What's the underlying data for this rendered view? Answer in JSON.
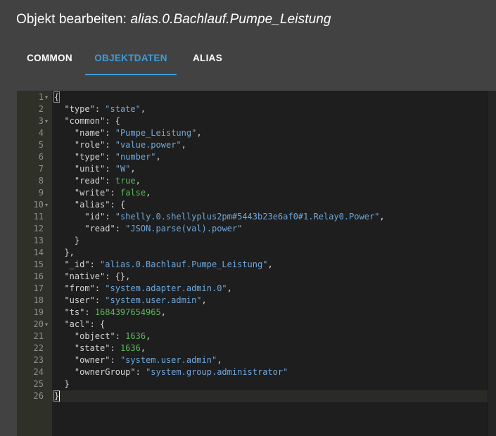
{
  "dialog": {
    "title_prefix": "Objekt bearbeiten: ",
    "title_object": "alias.0.Bachlauf.Pumpe_Leistung"
  },
  "tabs": [
    {
      "label": "COMMON",
      "active": false
    },
    {
      "label": "OBJEKTDATEN",
      "active": true
    },
    {
      "label": "ALIAS",
      "active": false
    }
  ],
  "editor": {
    "active_line": 26,
    "fold_lines": [
      1,
      3,
      10,
      20
    ],
    "lines": [
      [
        {
          "t": "p",
          "v": "{"
        }
      ],
      [
        {
          "t": "p",
          "v": "  "
        },
        {
          "t": "k",
          "v": "\"type\""
        },
        {
          "t": "p",
          "v": ": "
        },
        {
          "t": "s",
          "v": "\"state\""
        },
        {
          "t": "p",
          "v": ","
        }
      ],
      [
        {
          "t": "p",
          "v": "  "
        },
        {
          "t": "k",
          "v": "\"common\""
        },
        {
          "t": "p",
          "v": ": {"
        }
      ],
      [
        {
          "t": "p",
          "v": "    "
        },
        {
          "t": "k",
          "v": "\"name\""
        },
        {
          "t": "p",
          "v": ": "
        },
        {
          "t": "s",
          "v": "\"Pumpe_Leistung\""
        },
        {
          "t": "p",
          "v": ","
        }
      ],
      [
        {
          "t": "p",
          "v": "    "
        },
        {
          "t": "k",
          "v": "\"role\""
        },
        {
          "t": "p",
          "v": ": "
        },
        {
          "t": "s",
          "v": "\"value.power\""
        },
        {
          "t": "p",
          "v": ","
        }
      ],
      [
        {
          "t": "p",
          "v": "    "
        },
        {
          "t": "k",
          "v": "\"type\""
        },
        {
          "t": "p",
          "v": ": "
        },
        {
          "t": "s",
          "v": "\"number\""
        },
        {
          "t": "p",
          "v": ","
        }
      ],
      [
        {
          "t": "p",
          "v": "    "
        },
        {
          "t": "k",
          "v": "\"unit\""
        },
        {
          "t": "p",
          "v": ": "
        },
        {
          "t": "s",
          "v": "\"W\""
        },
        {
          "t": "p",
          "v": ","
        }
      ],
      [
        {
          "t": "p",
          "v": "    "
        },
        {
          "t": "k",
          "v": "\"read\""
        },
        {
          "t": "p",
          "v": ": "
        },
        {
          "t": "b",
          "v": "true"
        },
        {
          "t": "p",
          "v": ","
        }
      ],
      [
        {
          "t": "p",
          "v": "    "
        },
        {
          "t": "k",
          "v": "\"write\""
        },
        {
          "t": "p",
          "v": ": "
        },
        {
          "t": "b",
          "v": "false"
        },
        {
          "t": "p",
          "v": ","
        }
      ],
      [
        {
          "t": "p",
          "v": "    "
        },
        {
          "t": "k",
          "v": "\"alias\""
        },
        {
          "t": "p",
          "v": ": {"
        }
      ],
      [
        {
          "t": "p",
          "v": "      "
        },
        {
          "t": "k",
          "v": "\"id\""
        },
        {
          "t": "p",
          "v": ": "
        },
        {
          "t": "s",
          "v": "\"shelly.0.shellyplus2pm#5443b23e6af0#1.Relay0.Power\""
        },
        {
          "t": "p",
          "v": ","
        }
      ],
      [
        {
          "t": "p",
          "v": "      "
        },
        {
          "t": "k",
          "v": "\"read\""
        },
        {
          "t": "p",
          "v": ": "
        },
        {
          "t": "s",
          "v": "\"JSON.parse(val).power\""
        }
      ],
      [
        {
          "t": "p",
          "v": "    }"
        }
      ],
      [
        {
          "t": "p",
          "v": "  },"
        }
      ],
      [
        {
          "t": "p",
          "v": "  "
        },
        {
          "t": "k",
          "v": "\"_id\""
        },
        {
          "t": "p",
          "v": ": "
        },
        {
          "t": "s",
          "v": "\"alias.0.Bachlauf.Pumpe_Leistung\""
        },
        {
          "t": "p",
          "v": ","
        }
      ],
      [
        {
          "t": "p",
          "v": "  "
        },
        {
          "t": "k",
          "v": "\"native\""
        },
        {
          "t": "p",
          "v": ": {},"
        }
      ],
      [
        {
          "t": "p",
          "v": "  "
        },
        {
          "t": "k",
          "v": "\"from\""
        },
        {
          "t": "p",
          "v": ": "
        },
        {
          "t": "s",
          "v": "\"system.adapter.admin.0\""
        },
        {
          "t": "p",
          "v": ","
        }
      ],
      [
        {
          "t": "p",
          "v": "  "
        },
        {
          "t": "k",
          "v": "\"user\""
        },
        {
          "t": "p",
          "v": ": "
        },
        {
          "t": "s",
          "v": "\"system.user.admin\""
        },
        {
          "t": "p",
          "v": ","
        }
      ],
      [
        {
          "t": "p",
          "v": "  "
        },
        {
          "t": "k",
          "v": "\"ts\""
        },
        {
          "t": "p",
          "v": ": "
        },
        {
          "t": "n",
          "v": "1684397654965"
        },
        {
          "t": "p",
          "v": ","
        }
      ],
      [
        {
          "t": "p",
          "v": "  "
        },
        {
          "t": "k",
          "v": "\"acl\""
        },
        {
          "t": "p",
          "v": ": {"
        }
      ],
      [
        {
          "t": "p",
          "v": "    "
        },
        {
          "t": "k",
          "v": "\"object\""
        },
        {
          "t": "p",
          "v": ": "
        },
        {
          "t": "n",
          "v": "1636"
        },
        {
          "t": "p",
          "v": ","
        }
      ],
      [
        {
          "t": "p",
          "v": "    "
        },
        {
          "t": "k",
          "v": "\"state\""
        },
        {
          "t": "p",
          "v": ": "
        },
        {
          "t": "n",
          "v": "1636"
        },
        {
          "t": "p",
          "v": ","
        }
      ],
      [
        {
          "t": "p",
          "v": "    "
        },
        {
          "t": "k",
          "v": "\"owner\""
        },
        {
          "t": "p",
          "v": ": "
        },
        {
          "t": "s",
          "v": "\"system.user.admin\""
        },
        {
          "t": "p",
          "v": ","
        }
      ],
      [
        {
          "t": "p",
          "v": "    "
        },
        {
          "t": "k",
          "v": "\"ownerGroup\""
        },
        {
          "t": "p",
          "v": ": "
        },
        {
          "t": "s",
          "v": "\"system.group.administrator\""
        }
      ],
      [
        {
          "t": "p",
          "v": "  }"
        }
      ],
      [
        {
          "t": "p",
          "v": "}"
        }
      ]
    ]
  },
  "colors": {
    "background": "#424242",
    "accent": "#3e9bd6",
    "editor_bg": "#1e1e1e",
    "string": "#6fa8dc",
    "number": "#5db85c"
  }
}
